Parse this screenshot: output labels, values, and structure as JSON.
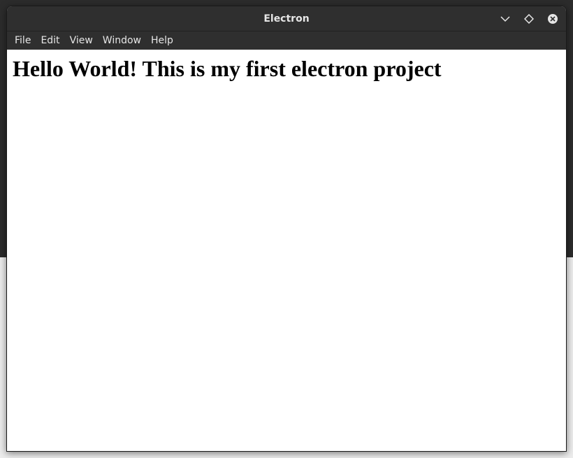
{
  "window": {
    "title": "Electron",
    "menu": [
      "File",
      "Edit",
      "View",
      "Window",
      "Help"
    ]
  },
  "content": {
    "heading": "Hello World! This is my first electron project"
  },
  "colors": {
    "titlebar": "#2f2f2f",
    "title_text": "#e6e6e6",
    "content_bg": "#ffffff"
  },
  "icons": [
    "minimize-chevron-icon",
    "maximize-diamond-icon",
    "close-circle-icon"
  ]
}
